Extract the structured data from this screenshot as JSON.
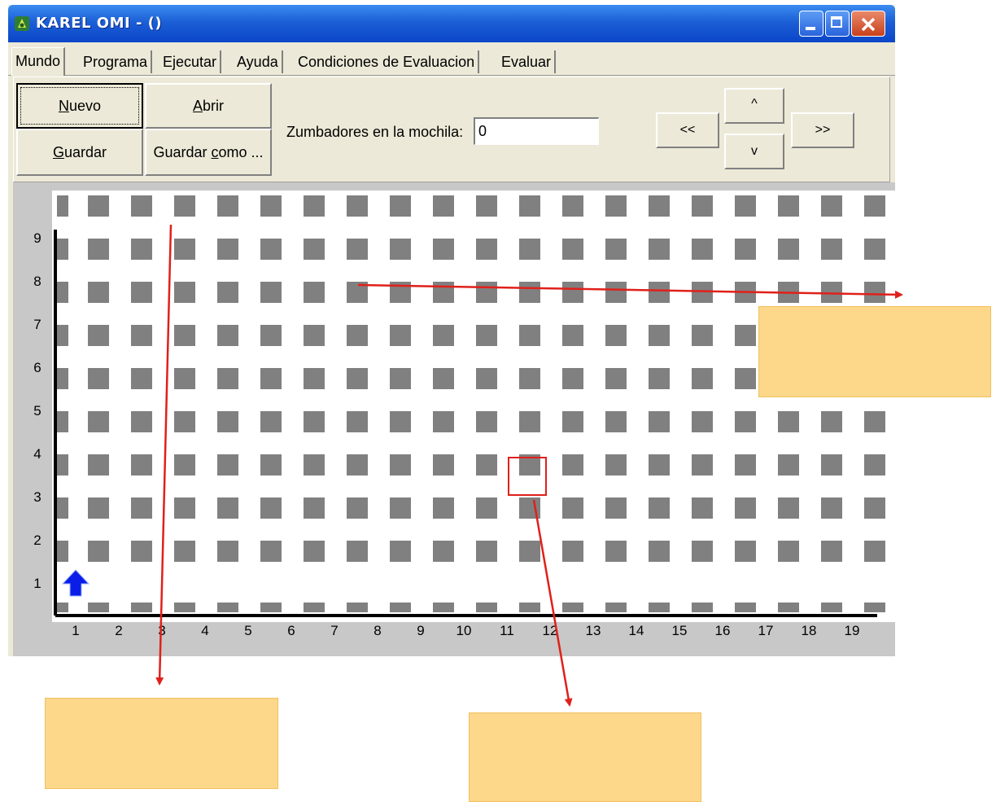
{
  "window": {
    "title": "KAREL OMI - ()"
  },
  "tabs": [
    {
      "label": "Mundo",
      "active": true
    },
    {
      "label": "Programa",
      "active": false
    },
    {
      "label": "Ejecutar",
      "active": false
    },
    {
      "label": "Ayuda",
      "active": false
    },
    {
      "label": "Condiciones de Evaluacion",
      "active": false
    },
    {
      "label": "Evaluar",
      "active": false
    }
  ],
  "toolbar": {
    "nuevo": {
      "accel": "N",
      "rest": "uevo"
    },
    "abrir": {
      "accel": "A",
      "rest": "brir"
    },
    "guardar": {
      "accel": "G",
      "rest": "uardar"
    },
    "guardar_como": {
      "pre": "Guardar ",
      "accel": "c",
      "rest": "omo ..."
    },
    "mochila_label": "Zumbadores en la mochila:",
    "mochila_value": "0",
    "nav": {
      "prev": "<<",
      "up": "^",
      "down": "v",
      "next": ">>"
    }
  },
  "world": {
    "x_labels": [
      "1",
      "2",
      "3",
      "4",
      "5",
      "6",
      "7",
      "8",
      "9",
      "10",
      "11",
      "12",
      "13",
      "14",
      "15",
      "16",
      "17",
      "18",
      "19"
    ],
    "y_labels": [
      "9",
      "8",
      "7",
      "6",
      "5",
      "4",
      "3",
      "2",
      "1"
    ],
    "robot": {
      "street": 1,
      "avenue": 1,
      "facing": "north",
      "color": "#0a1ee8"
    },
    "highlighted_cell": {
      "avenue": 11,
      "street": 3
    },
    "colors": {
      "block": "#808080",
      "axis": "#000000",
      "annotation_arrow": "#e0201a",
      "highlight": "#e0201a",
      "callout": "#fdd78a"
    }
  }
}
